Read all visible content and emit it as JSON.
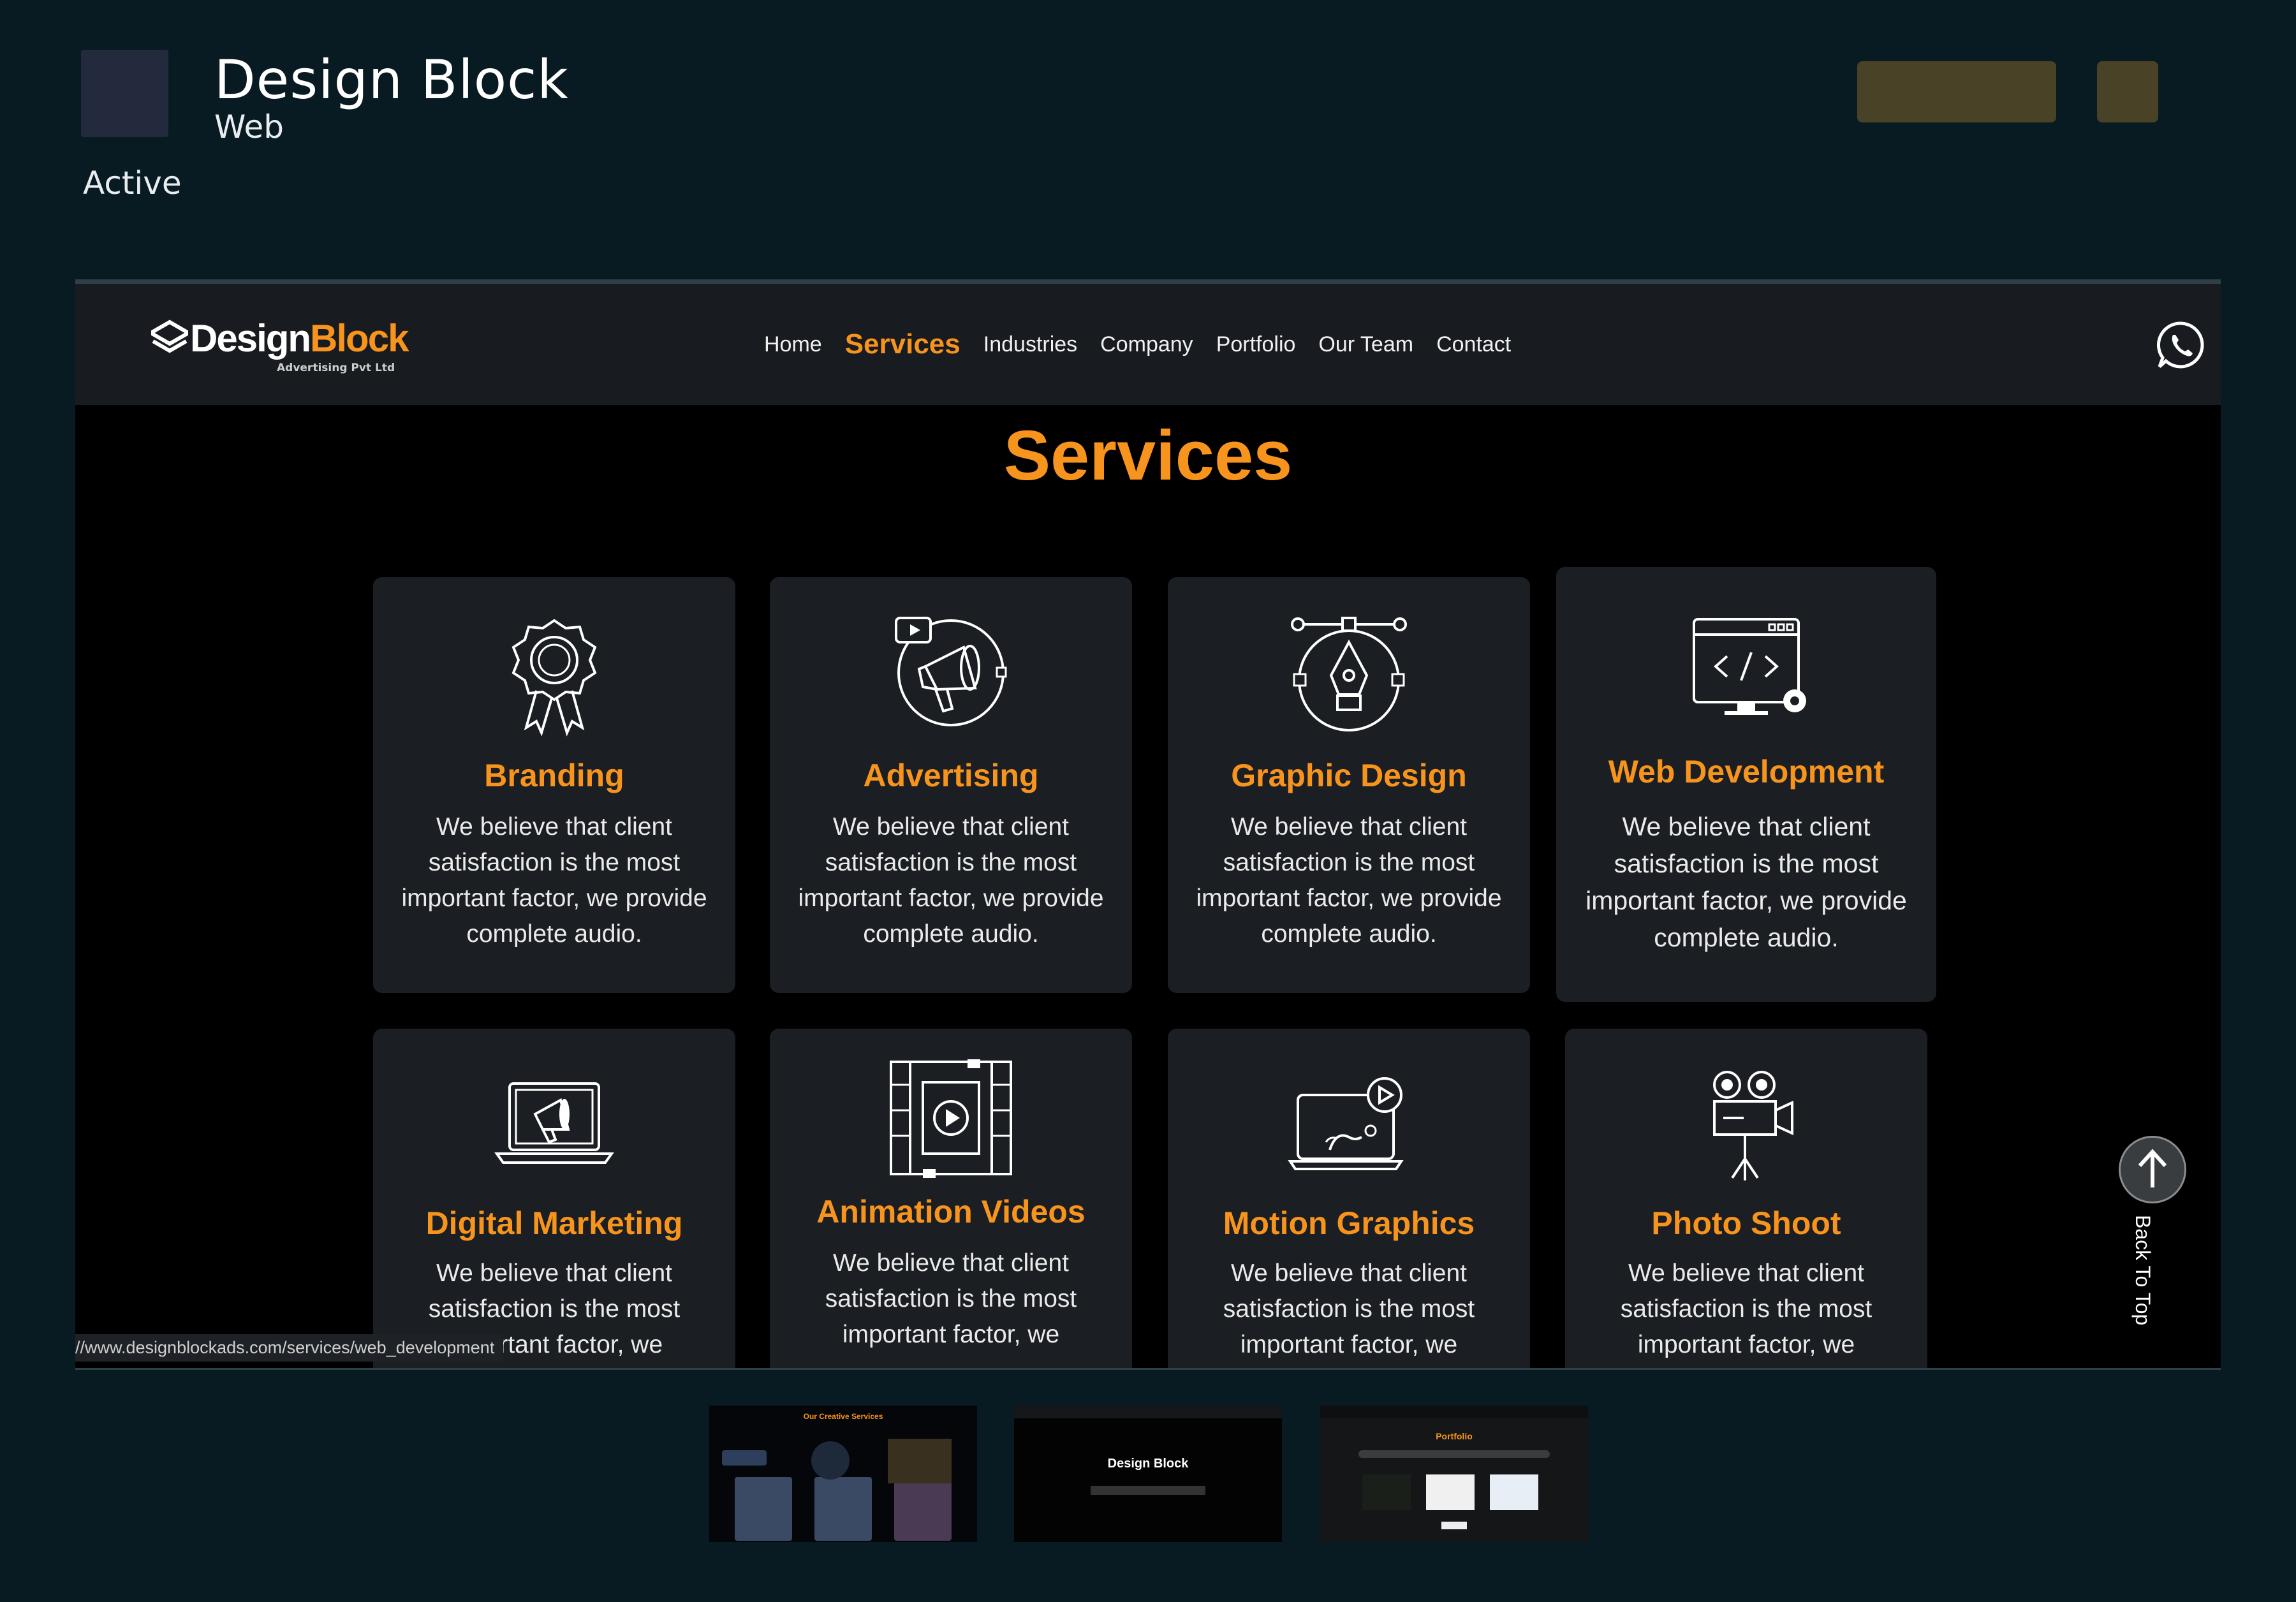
{
  "project": {
    "title": "Design Block",
    "type": "Web",
    "status": "Active"
  },
  "site": {
    "logo_main": "Design",
    "logo_accent": "Block",
    "logo_tagline": "Advertising Pvt Ltd",
    "nav": [
      "Home",
      "Services",
      "Industries",
      "Company",
      "Portfolio",
      "Our Team",
      "Contact"
    ],
    "nav_active": "Services",
    "section_title": "Services",
    "cards": [
      {
        "title": "Branding",
        "icon": "award-ribbon-icon",
        "desc": "We believe that client satisfaction is the most important factor, we provide complete audio."
      },
      {
        "title": "Advertising",
        "icon": "megaphone-icon",
        "desc": "We believe that client satisfaction is the most important factor, we provide complete audio."
      },
      {
        "title": "Graphic Design",
        "icon": "pen-tool-icon",
        "desc": "We believe that client satisfaction is the most important factor, we provide complete audio."
      },
      {
        "title": "Web Development",
        "icon": "code-monitor-icon",
        "desc": "We believe that client satisfaction is the most important factor, we provide complete audio."
      },
      {
        "title": "Digital Marketing",
        "icon": "laptop-megaphone-icon",
        "desc": "We believe that client satisfaction is the most important factor, we"
      },
      {
        "title": "Animation Videos",
        "icon": "film-play-icon",
        "desc": "We believe that client satisfaction is the most important factor, we"
      },
      {
        "title": "Motion Graphics",
        "icon": "motion-monitor-icon",
        "desc": "We believe that client satisfaction is the most important factor, we"
      },
      {
        "title": "Photo Shoot",
        "icon": "video-camera-icon",
        "desc": "We believe that client satisfaction is the most important factor, we"
      }
    ],
    "status_url": "//www.designblockads.com/services/web_development",
    "back_to_top": "Back To Top"
  },
  "thumbnails": [
    {
      "caption": "Our Creative Services"
    },
    {
      "caption": "Design Block"
    },
    {
      "caption": "Portfolio"
    }
  ],
  "colors": {
    "accent": "#f7941d",
    "background": "#081a22",
    "card": "#1b1e22"
  }
}
